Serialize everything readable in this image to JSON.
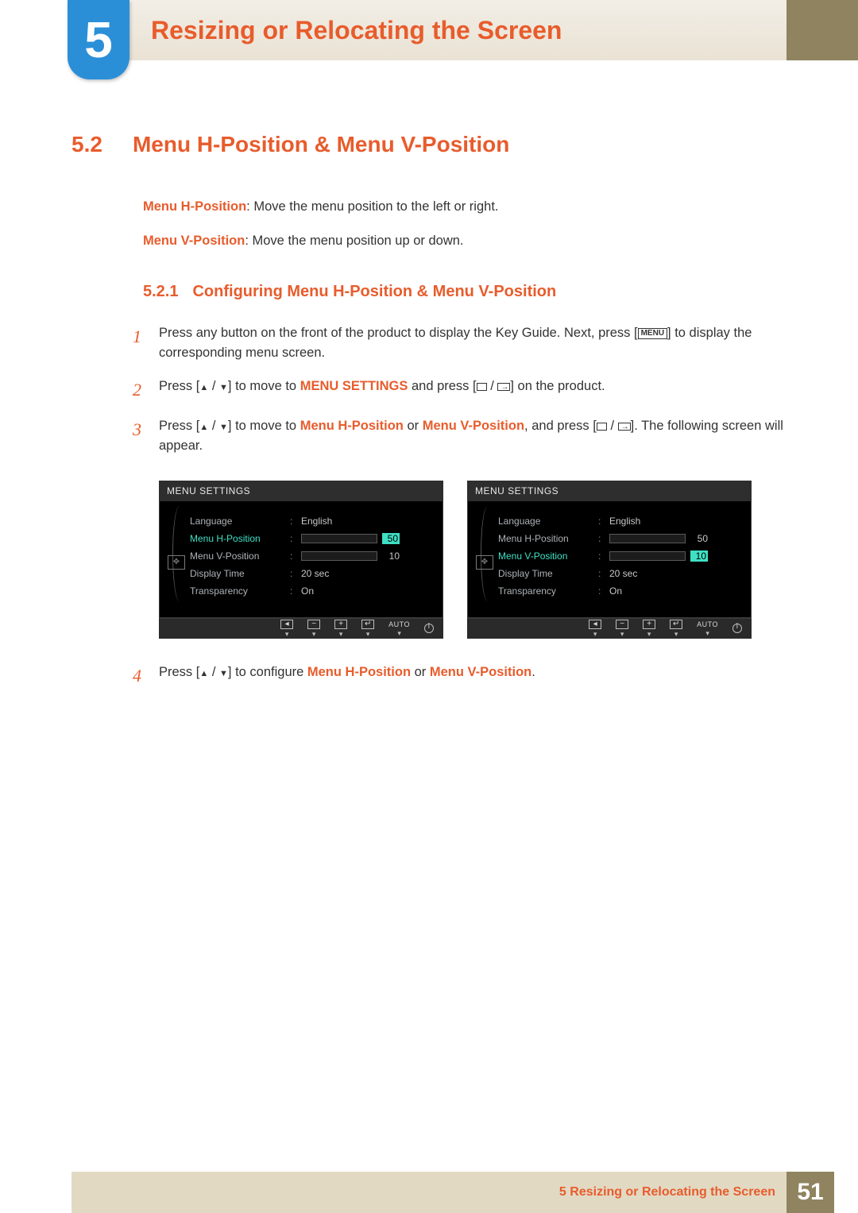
{
  "chapter": {
    "number": "5",
    "title": "Resizing or Relocating the Screen"
  },
  "section": {
    "number": "5.2",
    "title": "Menu H-Position & Menu V-Position"
  },
  "intro": {
    "h_label": "Menu H-Position",
    "h_desc": ": Move the menu position to the left or right.",
    "v_label": "Menu V-Position",
    "v_desc": ": Move the menu position up or down."
  },
  "subsection": {
    "number": "5.2.1",
    "title": "Configuring Menu H-Position & Menu V-Position"
  },
  "steps": {
    "s1_num": "1",
    "s1a": "Press any button on the front of the product to display the Key Guide. Next, press [",
    "s1_menu": "MENU",
    "s1b": "] to display the corresponding menu screen.",
    "s2_num": "2",
    "s2a": "Press [",
    "s2b": "] to move to ",
    "s2_menu_settings": "MENU SETTINGS",
    "s2c": " and press [",
    "s2d": "] on the product.",
    "s3_num": "3",
    "s3a": "Press [",
    "s3b": "] to move to ",
    "s3_h": "Menu H-Position",
    "s3_or": " or ",
    "s3_v": "Menu V-Position",
    "s3c": ", and press [",
    "s3d": "]. The following screen will appear.",
    "s4_num": "4",
    "s4a": "Press [",
    "s4b": "] to configure ",
    "s4_h": "Menu H-Position",
    "s4_or": " or ",
    "s4_v": "Menu V-Position",
    "s4c": "."
  },
  "osd": {
    "title": "MENU SETTINGS",
    "items": {
      "language": {
        "label": "Language",
        "value": "English"
      },
      "h_pos": {
        "label": "Menu H-Position",
        "value": "50"
      },
      "v_pos": {
        "label": "Menu V-Position",
        "value": "10"
      },
      "display_time": {
        "label": "Display Time",
        "value": "20 sec"
      },
      "transparency": {
        "label": "Transparency",
        "value": "On"
      }
    },
    "footer_auto": "AUTO"
  },
  "footer": {
    "text": "5 Resizing or Relocating the Screen",
    "page": "51"
  }
}
